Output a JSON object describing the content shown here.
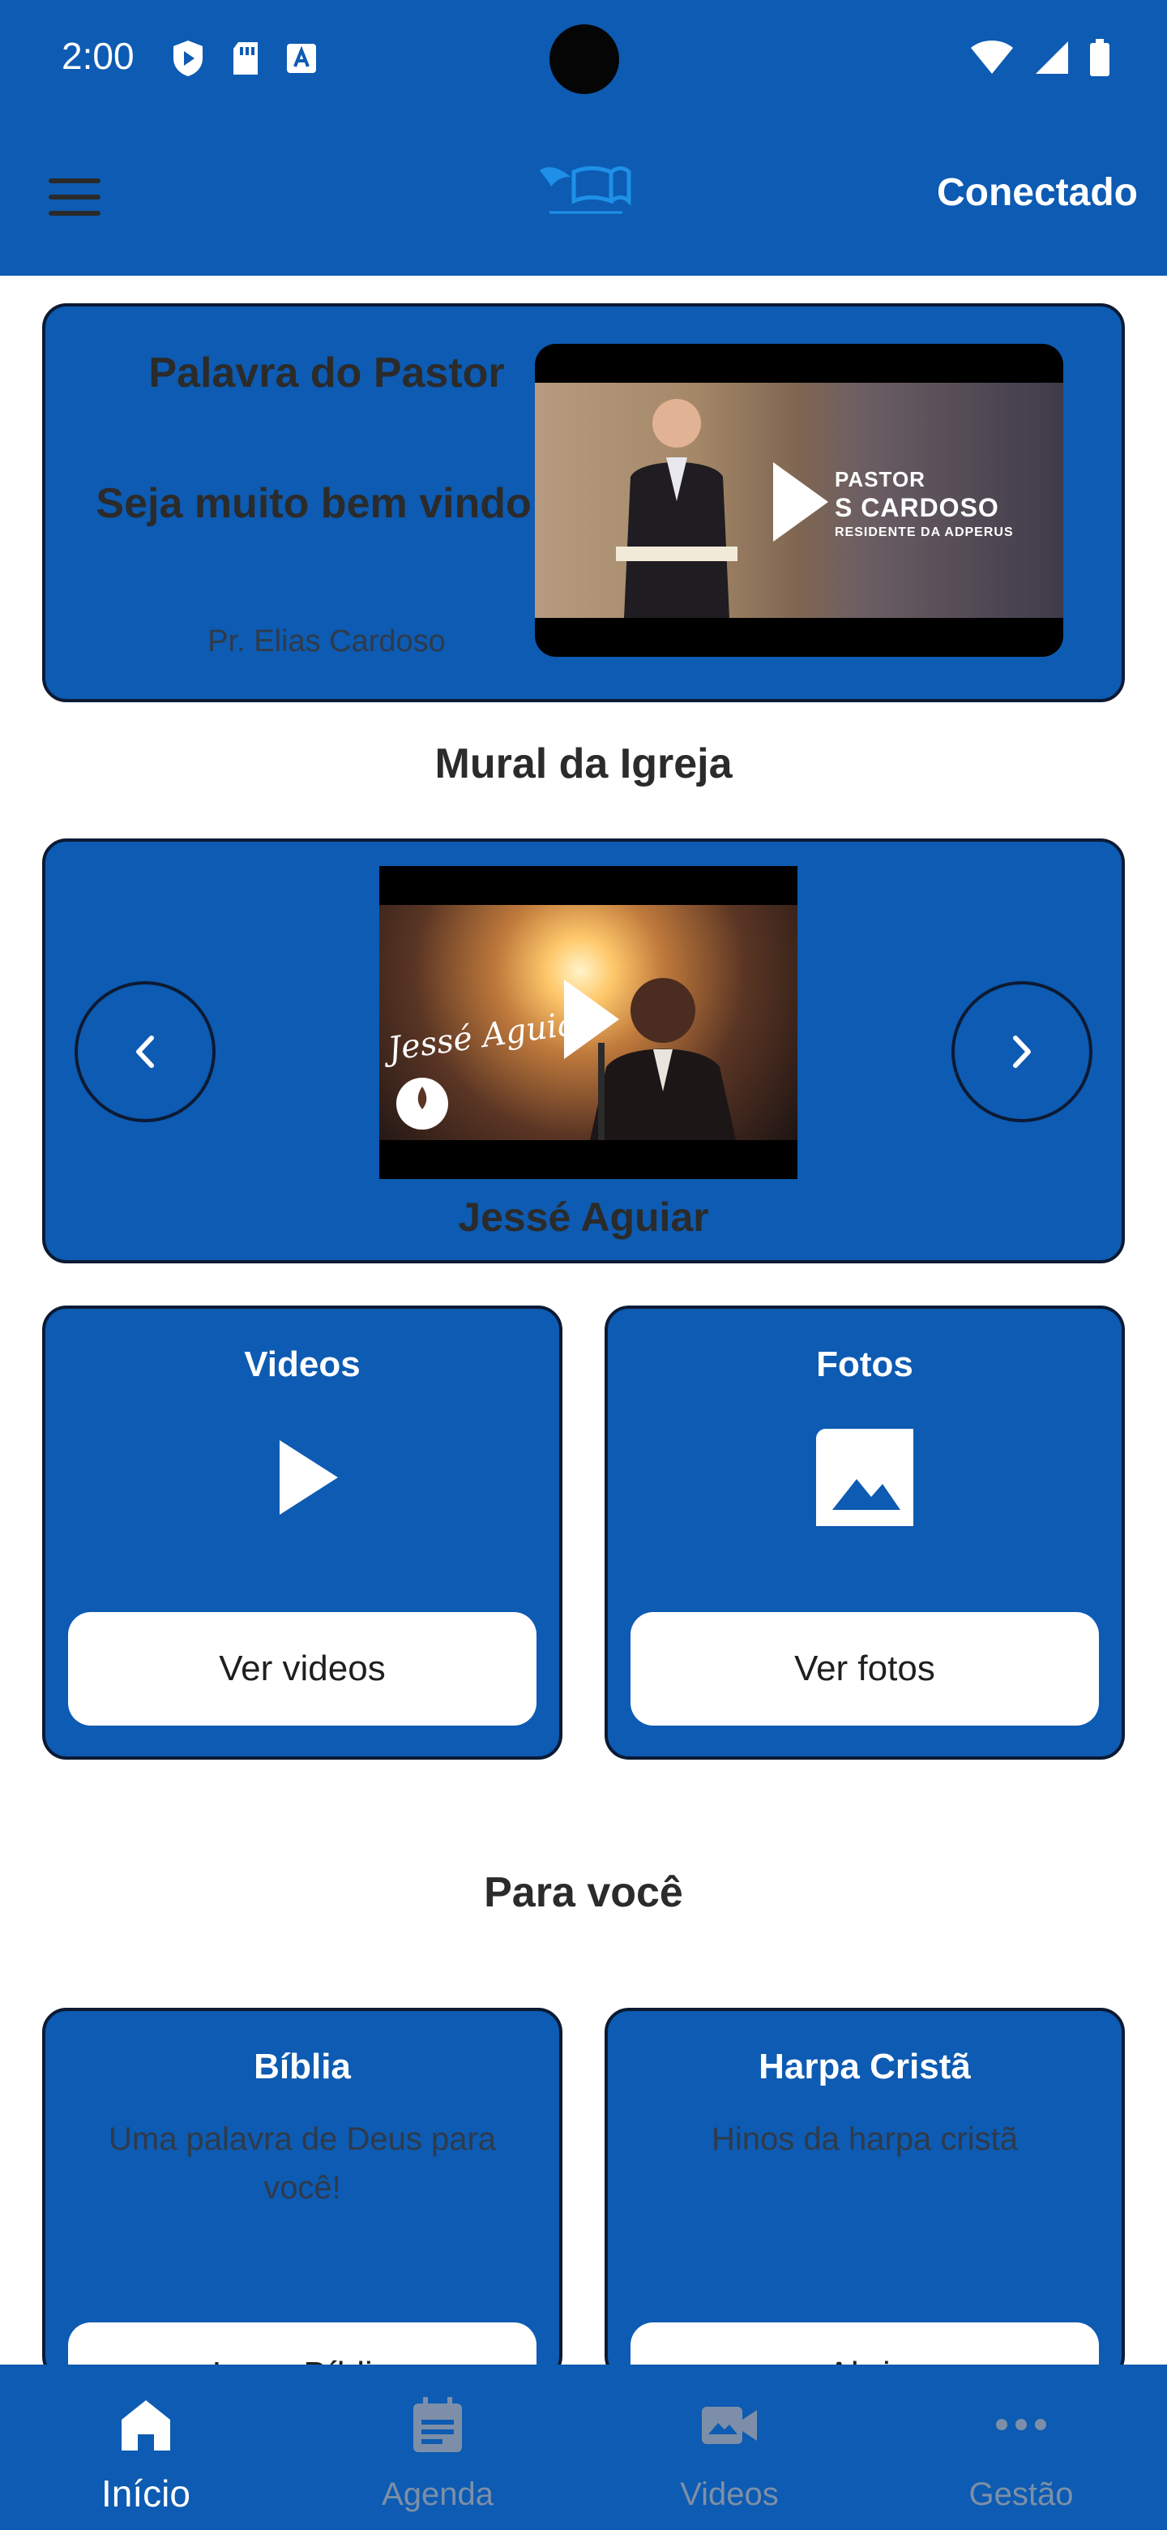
{
  "status_bar": {
    "time": "2:00"
  },
  "app_bar": {
    "connect_label": "Conectado"
  },
  "pastor_card": {
    "title": "Palavra do Pastor",
    "welcome": "Seja muito bem vindo !",
    "name": "Pr. Elias Cardoso",
    "video_overlay_line1": "PASTOR",
    "video_overlay_line2": "S CARDOSO",
    "video_overlay_line3": "RESIDENTE DA ADPERUS"
  },
  "mural": {
    "section_title": "Mural da Igreja",
    "video_script": "Jessé Aguiar",
    "caption": "Jessé Aguiar"
  },
  "tiles": [
    {
      "title": "Videos",
      "button": "Ver videos",
      "icon": "play-icon"
    },
    {
      "title": "Fotos",
      "button": "Ver fotos",
      "icon": "image-icon"
    }
  ],
  "for_you": {
    "section_title": "Para você",
    "tiles": [
      {
        "title": "Bíblia",
        "subtitle": "Uma palavra de Deus para você!",
        "button": "Ler a Bíblia"
      },
      {
        "title": "Harpa Cristã",
        "subtitle": "Hinos da harpa cristã",
        "button": "Abrir"
      }
    ]
  },
  "bottom_nav": [
    {
      "label": "Início",
      "icon": "home-icon",
      "active": true
    },
    {
      "label": "Agenda",
      "icon": "calendar-icon",
      "active": false
    },
    {
      "label": "Videos",
      "icon": "video-camera-icon",
      "active": false
    },
    {
      "label": "Gestão",
      "icon": "more-icon",
      "active": false
    }
  ],
  "colors": {
    "primary": "#0d5bb2",
    "border": "#0c1a33",
    "inactive_nav": "#7d8fa8"
  }
}
